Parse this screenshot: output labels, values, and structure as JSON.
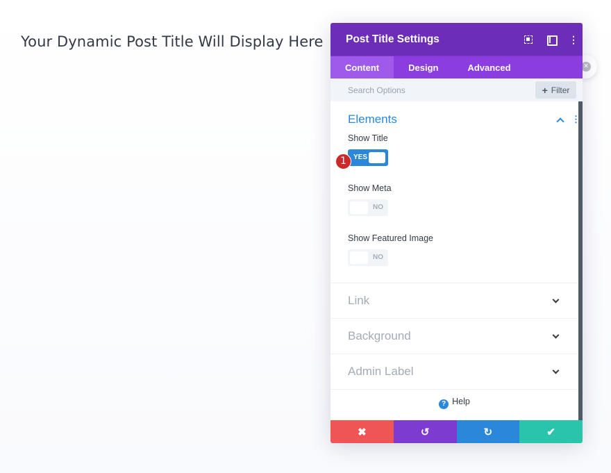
{
  "page": {
    "post_title": "Your Dynamic Post Title Will Display Here"
  },
  "modal": {
    "title": "Post Title Settings",
    "header_icons": [
      "expand-icon",
      "columns-icon",
      "more-options-icon"
    ],
    "tabs": [
      {
        "label": "Content",
        "active": true
      },
      {
        "label": "Design",
        "active": false
      },
      {
        "label": "Advanced",
        "active": false
      }
    ],
    "search": {
      "placeholder": "Search Options",
      "filter_label": "Filter",
      "filter_icon": "+"
    },
    "sections": {
      "elements": {
        "title": "Elements",
        "fields": [
          {
            "label": "Show Title",
            "state": "YES",
            "on": true
          },
          {
            "label": "Show Meta",
            "state": "NO",
            "on": false
          },
          {
            "label": "Show Featured Image",
            "state": "NO",
            "on": false
          }
        ]
      },
      "collapsed": [
        {
          "label": "Link"
        },
        {
          "label": "Background"
        },
        {
          "label": "Admin Label"
        }
      ]
    },
    "marker": "1",
    "help_label": "Help",
    "help_icon": "?",
    "footer": {
      "cancel_icon": "✖",
      "undo_icon": "↺",
      "redo_icon": "↻",
      "save_icon": "✔"
    }
  },
  "colors": {
    "header": "#6c2eb9",
    "tabs": "#8b3de0",
    "accent_blue": "#2b87da",
    "cancel": "#ef5555",
    "undo": "#7d3bcf",
    "redo": "#2b87da",
    "save": "#29c4a9",
    "marker": "#cc2a2a"
  }
}
